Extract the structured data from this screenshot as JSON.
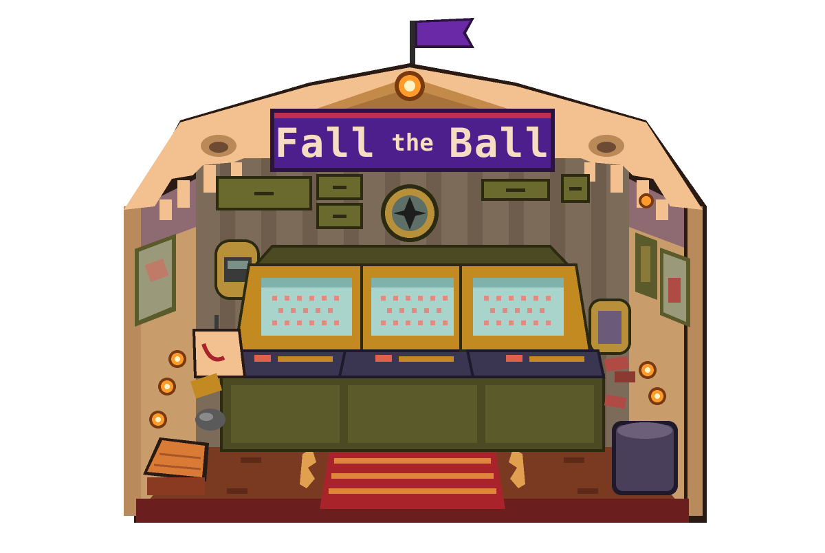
{
  "sign": {
    "title_word1": "Fall",
    "title_word2": "the",
    "title_word3": "Ball"
  },
  "colors": {
    "flag": "#6a2aa8",
    "sign_bg": "#4c1f8c",
    "sign_text": "#f6dcc0",
    "tent_canvas": "#f3c08f",
    "wall": "#7d6b59",
    "floor": "#7a3a22",
    "carpet_red": "#a8242a",
    "carpet_stripe": "#e0853c",
    "cabinet_gold": "#c48a22",
    "screen": "#a9d4cc",
    "cabinet_base": "#4b4a22",
    "lamp": "#ff9b2a"
  },
  "machines": [
    {
      "id": "machine-1"
    },
    {
      "id": "machine-2"
    },
    {
      "id": "machine-3"
    }
  ]
}
